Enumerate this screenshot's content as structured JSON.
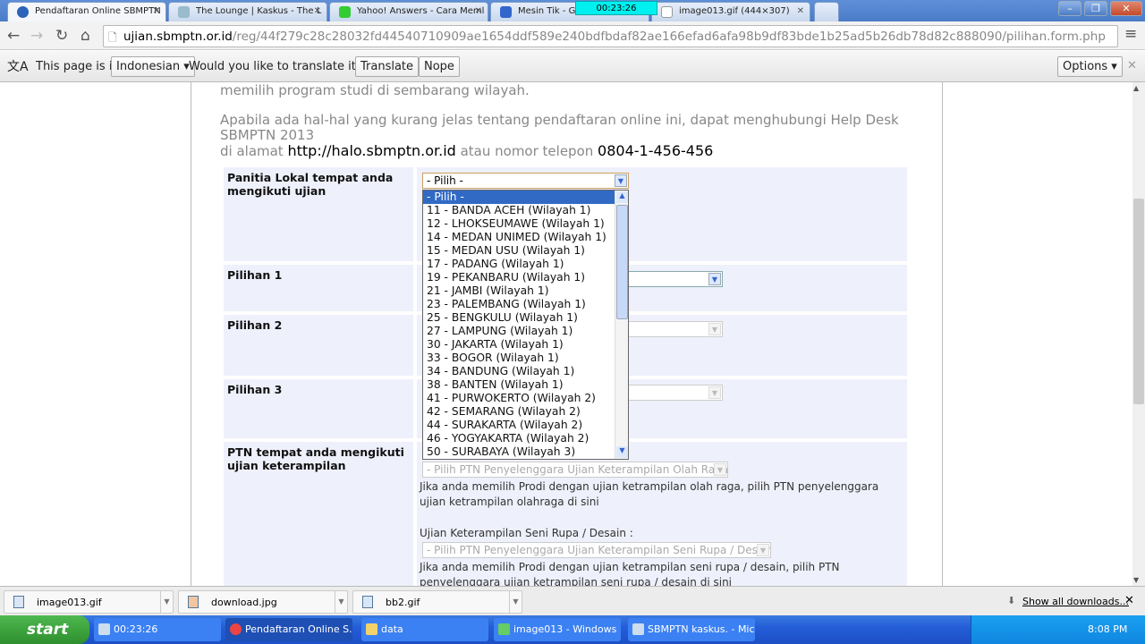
{
  "browser": {
    "tabs": [
      {
        "title": "Pendaftaran Online SBMPTN",
        "active": true,
        "icon": "sbmptn-icon"
      },
      {
        "title": "The Lounge | Kaskus - The L",
        "icon": "kaskus-icon"
      },
      {
        "title": "Yahoo! Answers - Cara Meml",
        "icon": "yahoo-answers-icon"
      },
      {
        "title": "Mesin Tik - Goo",
        "icon": "google-icon"
      },
      {
        "title": "image013.gif (444×307)",
        "icon": "file-icon"
      }
    ],
    "timer": "00:23:26",
    "url_host": "ujian.sbmptn.or.id",
    "url_path": "/reg/44f279c28c28032fd44540710909ae1654ddf589e240bdfbdaf82ae166efad6afa98b9df83bde1b25ad5b26db78d82c888090/pilihan.form.php",
    "translate": {
      "prefix": "This page is in",
      "language": "Indonesian",
      "question": "Would you like to translate it?",
      "translate_label": "Translate",
      "nope_label": "Nope",
      "options_label": "Options"
    }
  },
  "page": {
    "intro_line1": "memilih program studi di sembarang wilayah.",
    "intro_p2": "Apabila ada hal-hal yang kurang jelas tentang pendaftaran online ini, dapat menghubungi Help Desk SBMPTN 2013",
    "intro_p2b": "di alamat",
    "helpdesk_url": "http://halo.sbmptn.or.id",
    "intro_p2c": "atau nomor telepon",
    "phone": "0804-1-456-456",
    "form": {
      "panitia_label": "Panitia Lokal tempat anda mengikuti ujian",
      "panitia_value": "- Pilih -",
      "pilihan1_label": "Pilihan 1",
      "pilihan2_label": "Pilihan 2",
      "pilihan3_label": "Pilihan 3",
      "ptn_label": "PTN tempat anda mengikuti ujian keterampilan",
      "olahraga_select": "- Pilih PTN Penyelenggara Ujian Keterampilan Olah Raga -",
      "olahraga_note": "Jika anda memilih Prodi dengan ujian ketrampilan olah raga, pilih PTN penyelenggara ujian ketrampilan olahraga di sini",
      "senirupa_heading": "Ujian Keterampilan Seni Rupa / Desain :",
      "senirupa_select": "- Pilih PTN Penyelenggara Ujian Keterampilan Seni Rupa / Desain -",
      "senirupa_note": "Jika anda memilih Prodi dengan ujian ketrampilan seni rupa / desain, pilih PTN penyelenggara ujian ketrampilan seni rupa / desain di sini"
    },
    "dropdown_options": [
      "- Pilih -",
      "11 - BANDA ACEH (Wilayah 1)",
      "12 - LHOKSEUMAWE (Wilayah 1)",
      "14 - MEDAN UNIMED (Wilayah 1)",
      "15 - MEDAN USU (Wilayah 1)",
      "17 - PADANG (Wilayah 1)",
      "19 - PEKANBARU (Wilayah 1)",
      "21 - JAMBI (Wilayah 1)",
      "23 - PALEMBANG (Wilayah 1)",
      "25 - BENGKULU (Wilayah 1)",
      "27 - LAMPUNG (Wilayah 1)",
      "30 - JAKARTA (Wilayah 1)",
      "33 - BOGOR (Wilayah 1)",
      "34 - BANDUNG (Wilayah 1)",
      "38 - BANTEN (Wilayah 1)",
      "41 - PURWOKERTO (Wilayah 2)",
      "42 - SEMARANG (Wilayah 2)",
      "44 - SURAKARTA (Wilayah 2)",
      "46 - YOGYAKARTA (Wilayah 2)",
      "50 - SURABAYA (Wilayah 3)"
    ]
  },
  "downloads": {
    "items": [
      "image013.gif",
      "download.jpg",
      "bb2.gif"
    ],
    "show_all": "Show all downloads..."
  },
  "taskbar": {
    "start": "start",
    "tasks": [
      "00:23:26",
      "Pendaftaran Online S...",
      "data",
      "image013 - Windows ...",
      "SBMPTN kaskus. - Mic..."
    ],
    "clock": "8:08 PM"
  },
  "colors": {
    "highlight": "#316ac5",
    "form_bg": "#eef0fb",
    "timer": "#00f0f0"
  }
}
